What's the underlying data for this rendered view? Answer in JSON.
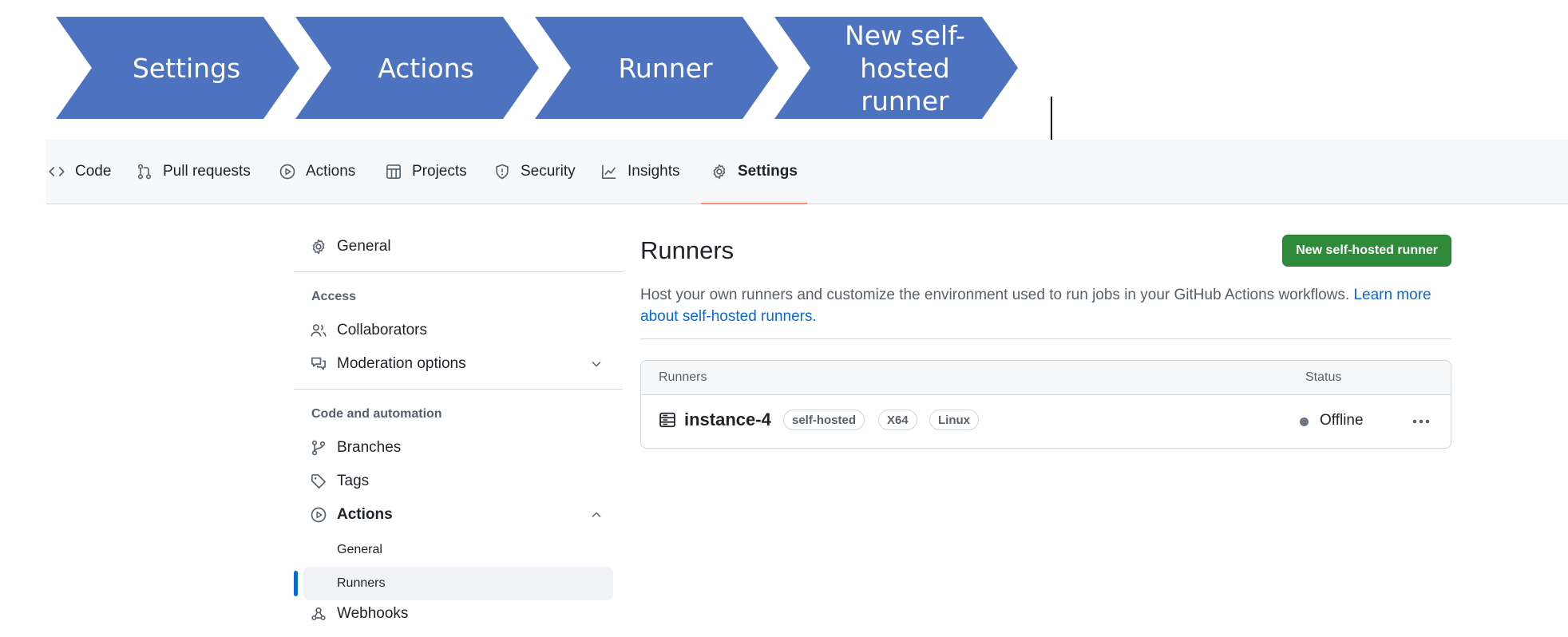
{
  "chevrons": [
    {
      "label": "Settings"
    },
    {
      "label": "Actions"
    },
    {
      "label": "Runner"
    },
    {
      "label": "New self-hosted runner"
    }
  ],
  "repo_nav": {
    "items": [
      {
        "label": "Code",
        "icon": "code-icon"
      },
      {
        "label": "Pull requests",
        "icon": "git-pull-request-icon"
      },
      {
        "label": "Actions",
        "icon": "play-icon"
      },
      {
        "label": "Projects",
        "icon": "table-icon"
      },
      {
        "label": "Security",
        "icon": "shield-icon"
      },
      {
        "label": "Insights",
        "icon": "graph-icon"
      },
      {
        "label": "Settings",
        "icon": "gear-icon",
        "active": true
      }
    ]
  },
  "sidebar": {
    "general": "General",
    "access_heading": "Access",
    "collaborators": "Collaborators",
    "moderation": "Moderation options",
    "code_heading": "Code and automation",
    "branches": "Branches",
    "tags": "Tags",
    "actions": "Actions",
    "actions_sub": [
      "General",
      "Runners"
    ],
    "webhooks": "Webhooks"
  },
  "main": {
    "title": "Runners",
    "new_button": "New self-hosted runner",
    "description": "Host your own runners and customize the environment used to run jobs in your GitHub Actions workflows. ",
    "learn_more": "Learn more about self-hosted runners.",
    "table": {
      "col_runners": "Runners",
      "col_status": "Status",
      "rows": [
        {
          "name": "instance-4",
          "labels": [
            "self-hosted",
            "X64",
            "Linux"
          ],
          "status": "Offline"
        }
      ]
    }
  },
  "colors": {
    "chevron": "#4c72c0",
    "accent_tab": "#fd8c73",
    "primary_button": "#2f8a3a",
    "link": "#0969da",
    "status_offline": "#6e7781"
  }
}
